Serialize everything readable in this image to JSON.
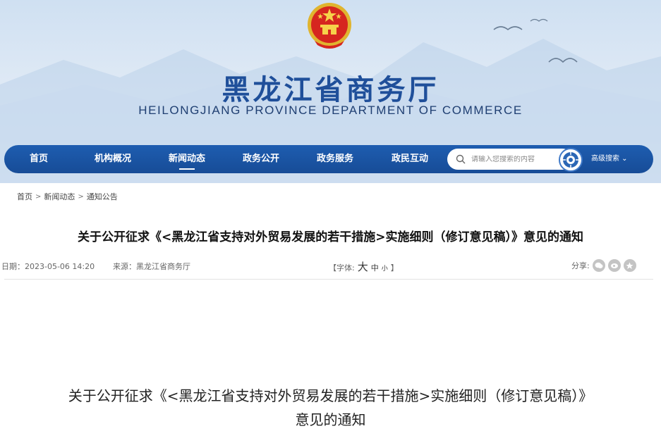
{
  "header": {
    "title_cn": "黑龙江省商务厅",
    "title_en": "HEILONGJIANG PROVINCE DEPARTMENT OF COMMERCE",
    "emblem_icon": "national-emblem-icon"
  },
  "nav": {
    "items": [
      {
        "label": "首页",
        "active": false
      },
      {
        "label": "机构概况",
        "active": false
      },
      {
        "label": "新闻动态",
        "active": true
      },
      {
        "label": "政务公开",
        "active": false
      },
      {
        "label": "政务服务",
        "active": false
      },
      {
        "label": "政民互动",
        "active": false
      }
    ],
    "search_placeholder": "请输入您搜索的内容",
    "advanced_search": "高级搜索 ⌄"
  },
  "breadcrumb": {
    "items": [
      "首页",
      "新闻动态",
      "通知公告"
    ],
    "separator": ">"
  },
  "article": {
    "title": "关于公开征求《<黑龙江省支持对外贸易发展的若干措施>实施细则（修订意见稿）》意见的通知",
    "date": "日期：2023-05-06 14:20",
    "source": "来源：黑龙江省商务厅",
    "font_label_open": "【字体:",
    "font_big": "大",
    "font_mid": "中",
    "font_small": "小",
    "font_label_close": "】",
    "share_label": "分享:",
    "body_heading_line1": "关于公开征求《<黑龙江省支持对外贸易发展的若干措施>实施细则（修订意见稿）》",
    "body_heading_line2": "意见的通知"
  },
  "colors": {
    "nav_bg": "#1a55a4",
    "title_blue": "#1f4f9a"
  }
}
